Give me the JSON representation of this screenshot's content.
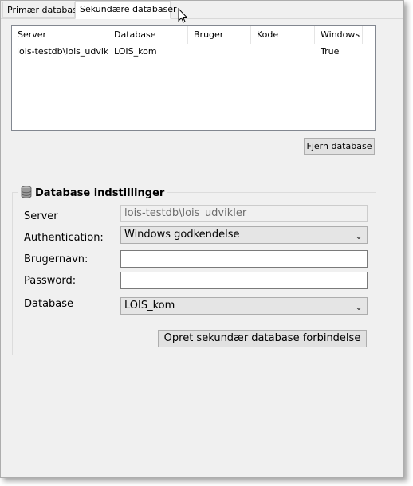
{
  "tabs": [
    {
      "label": "Primær database",
      "active": false
    },
    {
      "label": "Sekundære databaser",
      "active": true
    }
  ],
  "db_list": {
    "columns": [
      "Server",
      "Database",
      "Bruger",
      "Kode",
      "Windows"
    ],
    "rows": [
      [
        "lois-testdb\\lois_udvikler",
        "LOIS_kom",
        "",
        "",
        "True"
      ]
    ]
  },
  "remove_button": "Fjern database",
  "settings": {
    "title": "Database indstillinger",
    "server_label": "Server",
    "server_value": "lois-testdb\\lois_udvikler",
    "auth_label": "Authentication:",
    "auth_value": "Windows godkendelse",
    "user_label": "Brugernavn:",
    "user_value": "",
    "password_label": "Password:",
    "password_value": "",
    "database_label": "Database",
    "database_value": "LOIS_kom",
    "create_button": "Opret sekundær database forbindelse"
  },
  "icons": {
    "chevron": "chevron-down-icon",
    "group": "database-icon",
    "cursor": "mouse-pointer-icon"
  }
}
